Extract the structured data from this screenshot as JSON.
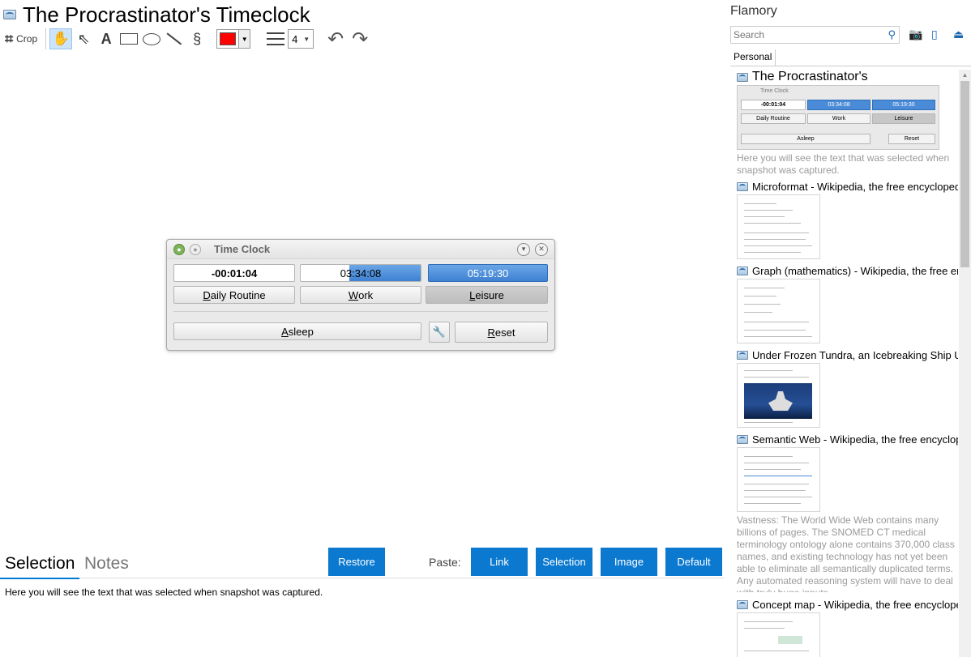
{
  "window": {
    "title": "The Procrastinator's Timeclock"
  },
  "toolbar": {
    "crop_label": "Crop",
    "tools": [
      "hand-icon",
      "pointer-icon",
      "text-icon",
      "rectangle-icon",
      "ellipse-icon",
      "line-icon",
      "freehand-icon"
    ],
    "text_tool_glyph": "A",
    "color": "#ff0000",
    "line_width": "4"
  },
  "timeclock": {
    "title": "Time Clock",
    "field1": "-00:01:04",
    "field2": "03:34:08",
    "field3": "05:19:30",
    "btn_daily_pre": "",
    "btn_daily_u": "D",
    "btn_daily_post": "aily Routine",
    "btn_work_pre": "",
    "btn_work_u": "W",
    "btn_work_post": "ork",
    "btn_leisure_pre": "",
    "btn_leisure_u": "L",
    "btn_leisure_post": "eisure",
    "btn_asleep_pre": "",
    "btn_asleep_u": "A",
    "btn_asleep_post": "sleep",
    "btn_reset_pre": "",
    "btn_reset_u": "R",
    "btn_reset_post": "eset"
  },
  "bottom": {
    "tabs": [
      "Selection",
      "Notes"
    ],
    "restore": "Restore",
    "paste_label": "Paste:",
    "paste_buttons": [
      "Link",
      "Selection",
      "Image",
      "Default"
    ],
    "selection_text": "Here you will see the text that was selected when snapshot was captured."
  },
  "sidebar": {
    "app_name": "Flamory",
    "search_placeholder": "Search",
    "tab": "Personal",
    "entries": [
      {
        "title": "The Procrastinator's",
        "desc": "Here you will see the text that was selected when snapshot was captured."
      },
      {
        "title": "Microformat - Wikipedia, the free encyclopedia",
        "desc": ""
      },
      {
        "title": "Graph (mathematics) - Wikipedia, the free ency",
        "desc": ""
      },
      {
        "title": "Under Frozen Tundra, an Icebreaking Ship Unco",
        "desc": ""
      },
      {
        "title": "Semantic Web - Wikipedia, the free encycloped",
        "desc": "Vastness: The World Wide Web contains many billions of pages. The SNOMED CT medical terminology ontology alone contains 370,000 class names, and existing technology has not yet been able to eliminate all semantically duplicated terms. Any automated reasoning system will have to deal with truly huge inputs."
      },
      {
        "title": "Concept map - Wikipedia, the free encyclopedi",
        "desc": ""
      }
    ],
    "mini": {
      "title": "Time Clock",
      "field1": "-00:01:04",
      "field2": "03:34:08",
      "field3": "05:19:30",
      "daily": "Daily Routine",
      "work": "Work",
      "leisure": "Leisure",
      "asleep": "Asleep",
      "reset": "Reset"
    }
  }
}
